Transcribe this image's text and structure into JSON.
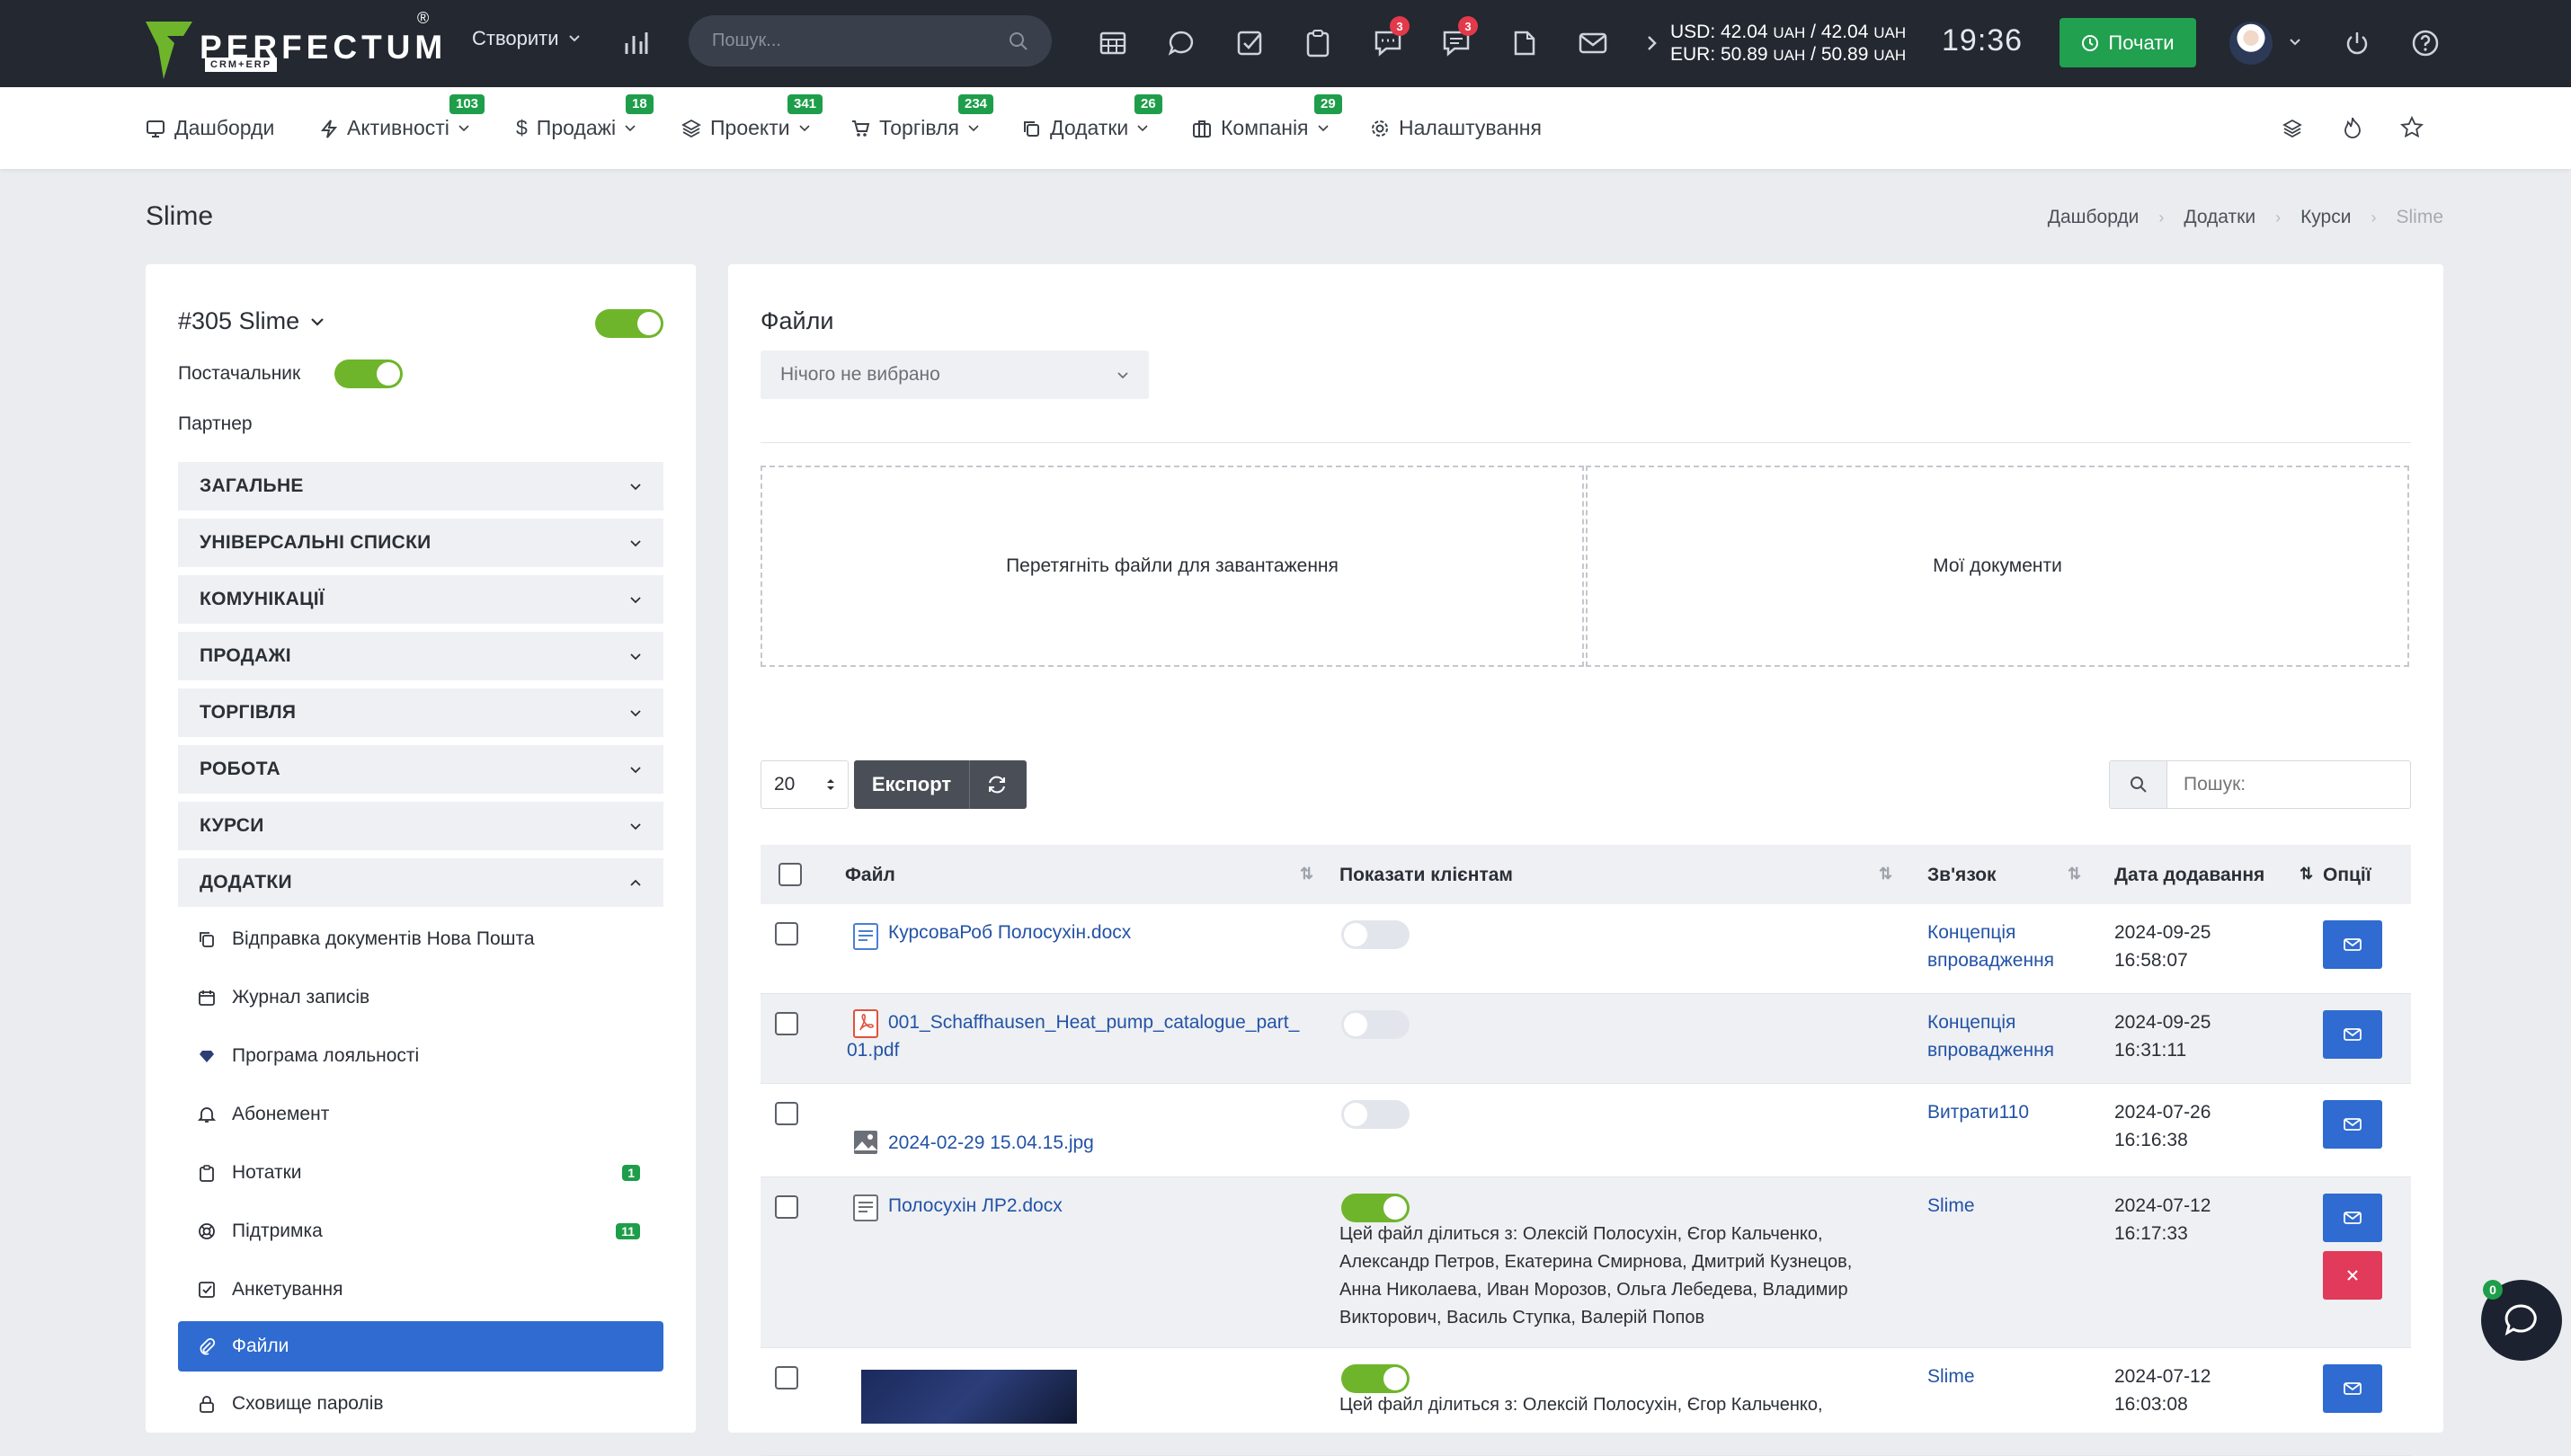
{
  "topbar": {
    "logo_text": "PERFECTUM",
    "logo_sub": "CRM+ERP",
    "logo_reg": "®",
    "create_label": "Створити",
    "search_placeholder": "Пошук...",
    "badge_chat": "3",
    "badge_messages": "3",
    "rate_usd": "USD: 42.04",
    "rate_usd_unit1": "UAH",
    "rate_usd_sep": "/ 42.04",
    "rate_usd_unit2": "UAH",
    "rate_eur": "EUR: 50.89",
    "rate_eur_unit1": "UAH",
    "rate_eur_sep": "/ 50.89",
    "rate_eur_unit2": "UAH",
    "clock": "19:36",
    "start_label": "Почати"
  },
  "nav": {
    "items": [
      {
        "label": "Дашборди",
        "badge": ""
      },
      {
        "label": "Активності",
        "badge": "103"
      },
      {
        "label": "Продажі",
        "badge": "18"
      },
      {
        "label": "Проекти",
        "badge": "341"
      },
      {
        "label": "Торгівля",
        "badge": "234"
      },
      {
        "label": "Додатки",
        "badge": "26"
      },
      {
        "label": "Компанія",
        "badge": "29"
      },
      {
        "label": "Налаштування",
        "badge": ""
      }
    ]
  },
  "page": {
    "title": "Slime",
    "breadcrumbs": [
      "Дашборди",
      "Додатки",
      "Курси",
      "Slime"
    ]
  },
  "left": {
    "record_title": "#305 Slime",
    "supplier_label": "Постачальник",
    "partner_label": "Партнер",
    "sections": [
      "ЗАГАЛЬНЕ",
      "УНІВЕРСАЛЬНІ СПИСКИ",
      "КОМУНІКАЦІЇ",
      "ПРОДАЖІ",
      "ТОРГІВЛЯ",
      "РОБОТА",
      "КУРСИ",
      "ДОДАТКИ"
    ],
    "subitems": [
      {
        "label": "Відправка документів Нова Пошта",
        "badge": ""
      },
      {
        "label": "Журнал записів",
        "badge": ""
      },
      {
        "label": "Програма лояльності",
        "badge": ""
      },
      {
        "label": "Абонемент",
        "badge": ""
      },
      {
        "label": "Нотатки",
        "badge": "1"
      },
      {
        "label": "Підтримка",
        "badge": "11"
      },
      {
        "label": "Анкетування",
        "badge": ""
      },
      {
        "label": "Файли",
        "badge": ""
      },
      {
        "label": "Сховище паролів",
        "badge": ""
      }
    ]
  },
  "files": {
    "heading": "Файли",
    "select_placeholder": "Нічого не вибрано",
    "drop_label": "Перетягніть файли для завантаження",
    "mydocs_label": "Мої документи",
    "page_size": "20",
    "export_label": "Експорт",
    "search_placeholder": "Пошук:",
    "columns": [
      "Файл",
      "Показати клієнтам",
      "Зв'язок",
      "Дата додавання",
      "Опції"
    ],
    "rows": [
      {
        "file": "КурсоваРоб Полосухін.docx",
        "shown": false,
        "share": "",
        "link1": "Концепція",
        "link2": "впровадження",
        "date": "2024-09-25",
        "time": "16:58:07"
      },
      {
        "file1": "001_Schaffhausen_Heat_pump_catalogue_part_",
        "file2": "01.pdf",
        "shown": false,
        "share": "",
        "link1": "Концепція",
        "link2": "впровадження",
        "date": "2024-09-25",
        "time": "16:31:11"
      },
      {
        "file": "2024-02-29 15.04.15.jpg",
        "shown": false,
        "share": "",
        "link1": "Витрати110",
        "link2": "",
        "date": "2024-07-26",
        "time": "16:16:38"
      },
      {
        "file": "Полосухін ЛР2.docx",
        "shown": true,
        "share1": "Цей файл ділиться з: Олексій Полосухін, Єгор Кальченко,",
        "share2": "Александр Петров, Екатерина Смирнова, Дмитрий Кузнецов,",
        "share3": "Анна Николаева, Иван Морозов, Ольга Лебедева, Владимир",
        "share4": "Викторович, Василь Ступка, Валерій Попов",
        "link1": "Slime",
        "link2": "",
        "date": "2024-07-12",
        "time": "16:17:33"
      },
      {
        "file": "",
        "shown": true,
        "share1": "Цей файл ділиться з: Олексій Полосухін, Єгор Кальченко,",
        "link1": "Slime",
        "link2": "",
        "date": "2024-07-12",
        "time": "16:03:08"
      }
    ]
  },
  "chat_badge": "0",
  "colors": {
    "topbar": "#232831",
    "accent_green": "#21a04f",
    "primary_blue": "#2f6bd0",
    "danger": "#e23a5a",
    "toggle_on": "#6fb52c"
  }
}
